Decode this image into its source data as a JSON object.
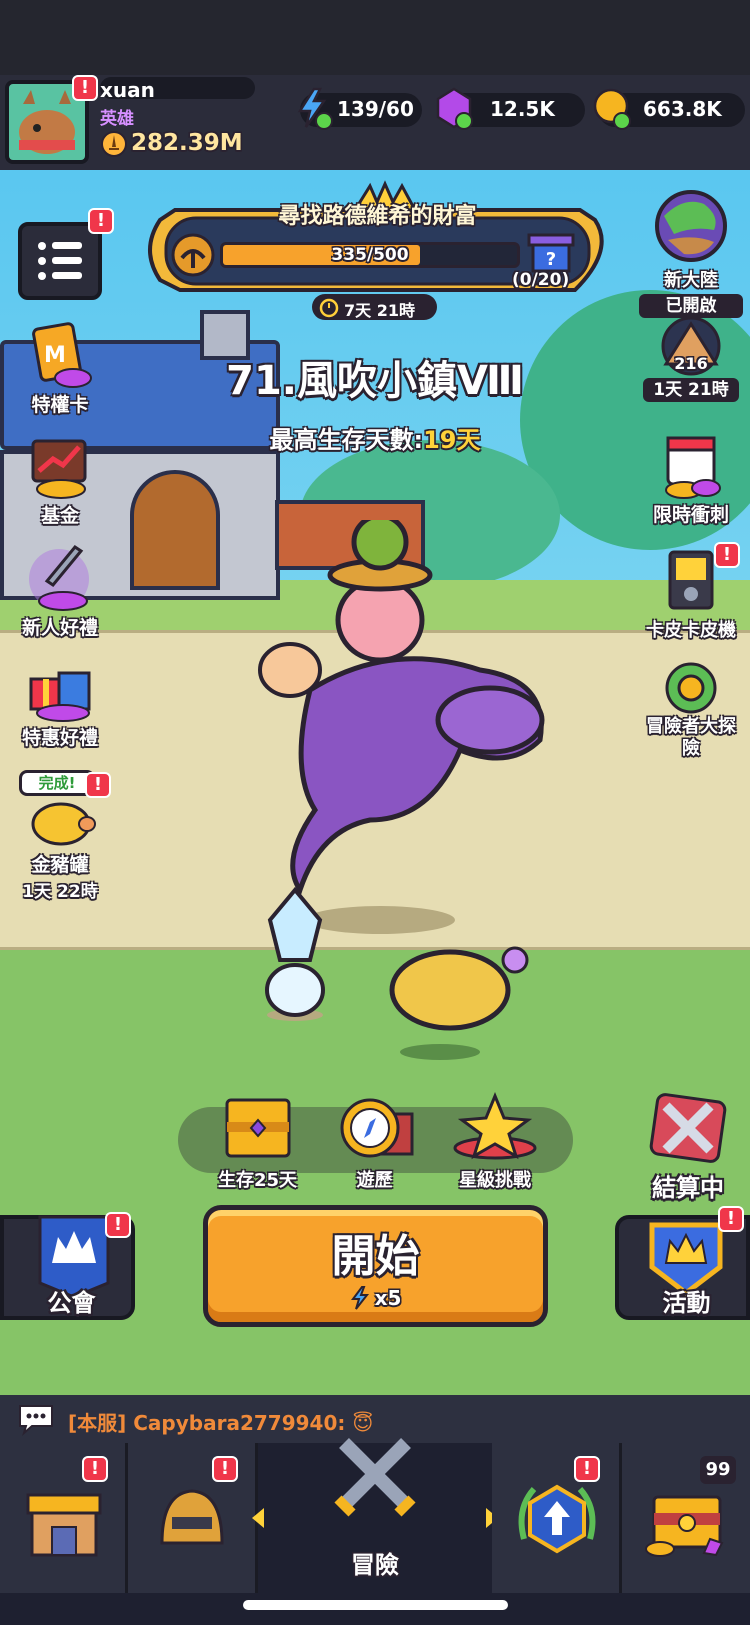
{
  "player": {
    "name": "xuan",
    "rank": "英雄",
    "power": "282.39M"
  },
  "resources": {
    "energy": "139/60",
    "gems": "12.5K",
    "gold": "663.8K"
  },
  "event": {
    "title": "尋找路德維希的財富",
    "progress_text": "335/500",
    "progress": 0.67,
    "reward_count": "(0/20)",
    "timer": "7天 21時"
  },
  "stage": {
    "name": "71.風吹小鎮Ⅷ",
    "best_label": "最高生存天數:",
    "best_value": "19天"
  },
  "left_menu": [
    {
      "label": "特權卡"
    },
    {
      "label": "基金"
    },
    {
      "label": "新人好禮"
    },
    {
      "label": "特惠好禮"
    },
    {
      "label": "金豬罐",
      "sub": "1天 22時",
      "tag": "完成!"
    }
  ],
  "right_menu": {
    "continent": {
      "label": "新大陸",
      "status": "已開啟"
    },
    "pyramid": {
      "value": "216",
      "timer": "1天 21時"
    },
    "sprint": {
      "label": "限時衝刺"
    },
    "gacha": {
      "label": "卡皮卡皮機"
    },
    "explore": {
      "label": "冒險者大探險"
    }
  },
  "action_row": [
    {
      "label": "生存25天"
    },
    {
      "label": "遊歷"
    },
    {
      "label": "星級挑戰"
    }
  ],
  "settle": {
    "label": "結算中"
  },
  "start": {
    "label": "開始",
    "cost": "x5"
  },
  "guild": {
    "label": "公會"
  },
  "activity": {
    "label": "活動"
  },
  "chat": {
    "server": "[本服]",
    "user": "Capybara2779940:",
    "emoji": "😇"
  },
  "nav": {
    "center_label": "冒險",
    "chest_count": "99",
    "alert": "!"
  },
  "colors": {
    "accent_orange": "#f7a22c",
    "alert_red": "#f0364a",
    "gold_text": "#ffd23a"
  }
}
